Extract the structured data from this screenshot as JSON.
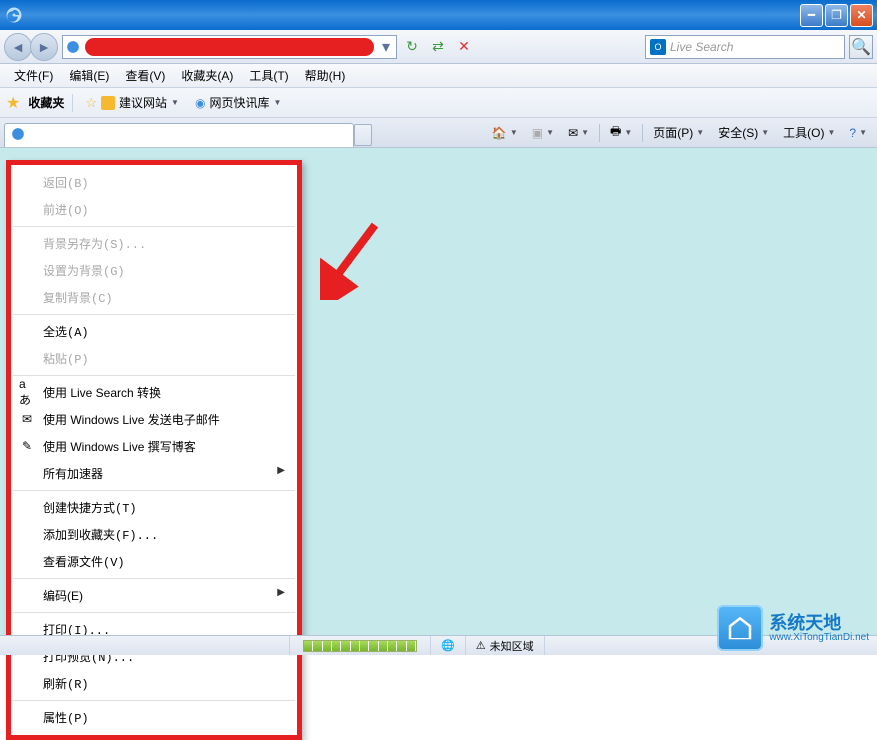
{
  "titlebar": {},
  "navbar": {
    "search_placeholder": "Live Search"
  },
  "menu": {
    "file": "文件(F)",
    "edit": "编辑(E)",
    "view": "查看(V)",
    "favorites": "收藏夹(A)",
    "tools": "工具(T)",
    "help": "帮助(H)"
  },
  "favbar": {
    "label": "收藏夹",
    "suggest": "建议网站",
    "quick": "网页快讯库"
  },
  "toolbar": {
    "page": "页面(P)",
    "safety": "安全(S)",
    "tools": "工具(O)"
  },
  "context": {
    "back": "返回(B)",
    "forward": "前进(O)",
    "save_bg_as": "背景另存为(S)...",
    "set_as_bg": "设置为背景(G)",
    "copy_bg": "复制背景(C)",
    "select_all": "全选(A)",
    "paste": "粘贴(P)",
    "live_translate": "使用 Live Search 转换",
    "live_email": "使用 Windows Live 发送电子邮件",
    "live_blog": "使用 Windows Live 撰写博客",
    "all_accel": "所有加速器",
    "create_shortcut": "创建快捷方式(T)",
    "add_to_fav": "添加到收藏夹(F)...",
    "view_source": "查看源文件(V)",
    "encoding": "编码(E)",
    "print": "打印(I)...",
    "print_preview": "打印预览(N)...",
    "refresh": "刷新(R)",
    "properties": "属性(P)"
  },
  "status": {
    "zone": "未知区域"
  },
  "watermark": {
    "name": "系统天地",
    "url": "www.XiTongTianDi.net"
  }
}
